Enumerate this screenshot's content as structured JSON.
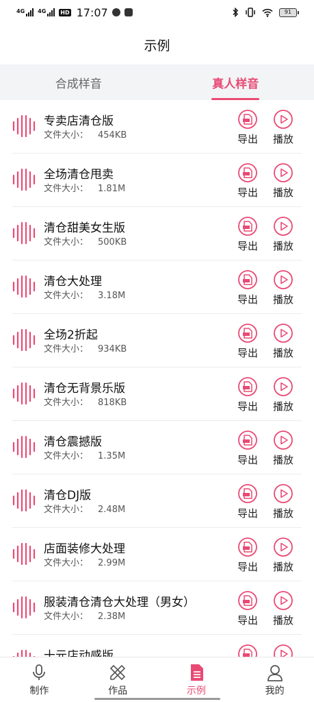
{
  "status_bar": {
    "signal1": "4G",
    "signal2": "4G",
    "hd": "HD",
    "time": "17:07",
    "battery": "91"
  },
  "header": {
    "title": "示例"
  },
  "tabs": [
    {
      "label": "合成样音",
      "active": false
    },
    {
      "label": "真人样音",
      "active": true
    }
  ],
  "size_label": "文件大小：",
  "actions": {
    "export_label": "导出",
    "play_label": "播放"
  },
  "items": [
    {
      "title": "专卖店清仓版",
      "size": "454KB"
    },
    {
      "title": "全场清仓甩卖",
      "size": "1.81M"
    },
    {
      "title": "清仓甜美女生版",
      "size": "500KB"
    },
    {
      "title": "清仓大处理",
      "size": "3.18M"
    },
    {
      "title": "全场2折起",
      "size": "934KB"
    },
    {
      "title": "清仓无背景乐版",
      "size": "818KB"
    },
    {
      "title": "清仓震撼版",
      "size": "1.35M"
    },
    {
      "title": "清仓DJ版",
      "size": "2.48M"
    },
    {
      "title": "店面装修大处理",
      "size": "2.99M"
    },
    {
      "title": "服装清仓清仓大处理（男女）",
      "size": "2.38M"
    },
    {
      "title": "十元店动感版",
      "size": ""
    }
  ],
  "bottom_nav": [
    {
      "label": "制作",
      "icon": "microphone-icon",
      "active": false
    },
    {
      "label": "作品",
      "icon": "pencil-ruler-icon",
      "active": false
    },
    {
      "label": "示例",
      "icon": "document-icon",
      "active": true
    },
    {
      "label": "我的",
      "icon": "user-icon",
      "active": false
    }
  ],
  "colors": {
    "accent": "#e84a74",
    "tab_bg": "#f3f4f6"
  }
}
